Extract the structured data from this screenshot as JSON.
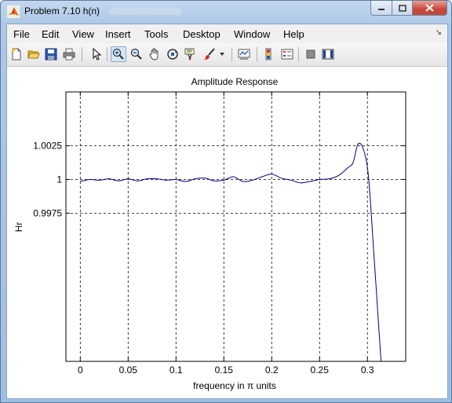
{
  "window": {
    "title": "Problem 7.10 h(n)"
  },
  "menu": [
    "File",
    "Edit",
    "View",
    "Insert",
    "Tools",
    "Desktop",
    "Window",
    "Help"
  ],
  "toolbar_icons": [
    "new-figure-icon",
    "open-file-icon",
    "save-icon",
    "print-icon",
    "pointer-icon",
    "zoom-in-icon",
    "zoom-out-icon",
    "pan-hand-icon",
    "rotate-3d-icon",
    "data-cursor-icon",
    "brush-icon",
    "link-plot-icon",
    "colorbar-icon",
    "legend-icon",
    "hide-plot-tools-icon",
    "show-plot-tools-icon"
  ],
  "chart_data": {
    "type": "line",
    "title": "Amplitude Response",
    "xlabel": "frequency in π units",
    "ylabel": "Hr",
    "xlim": [
      -0.015,
      0.34
    ],
    "ylim": [
      0.9865,
      1.0065
    ],
    "xticks": [
      0,
      0.05,
      0.1,
      0.15,
      0.2,
      0.25,
      0.3
    ],
    "xtick_labels": [
      "0",
      "0.05",
      "0.1",
      "0.15",
      "0.2",
      "0.25",
      "0.3"
    ],
    "yticks": [
      0.9975,
      1,
      1.0025
    ],
    "ytick_labels": [
      "0.9975",
      "1",
      "1.0025"
    ],
    "grid": true,
    "grid_style": "dashed",
    "series": [
      {
        "color": "#00007f",
        "x": [
          0,
          0.01,
          0.02,
          0.03,
          0.04,
          0.05,
          0.06,
          0.07,
          0.08,
          0.09,
          0.1,
          0.11,
          0.12,
          0.13,
          0.14,
          0.15,
          0.16,
          0.17,
          0.18,
          0.19,
          0.2,
          0.21,
          0.22,
          0.23,
          0.24,
          0.25,
          0.26,
          0.27,
          0.28,
          0.285,
          0.29,
          0.295,
          0.3,
          0.303,
          0.306,
          0.309,
          0.312,
          0.315
        ],
        "y": [
          0.99985,
          1.0,
          0.99995,
          1.00005,
          0.9999,
          1.00005,
          0.9999,
          1.00005,
          1.00005,
          0.99995,
          1.0,
          0.99985,
          1.00005,
          1.0001,
          0.9999,
          0.99995,
          1.0002,
          0.99985,
          0.99995,
          1.0002,
          1.0004,
          1.0001,
          0.99995,
          0.99975,
          0.99985,
          1.0,
          1.00005,
          1.0003,
          1.0009,
          1.00125,
          1.0026,
          1.0024,
          1.0009,
          0.9985,
          0.9953,
          0.9921,
          0.9889,
          0.9857
        ]
      }
    ]
  }
}
